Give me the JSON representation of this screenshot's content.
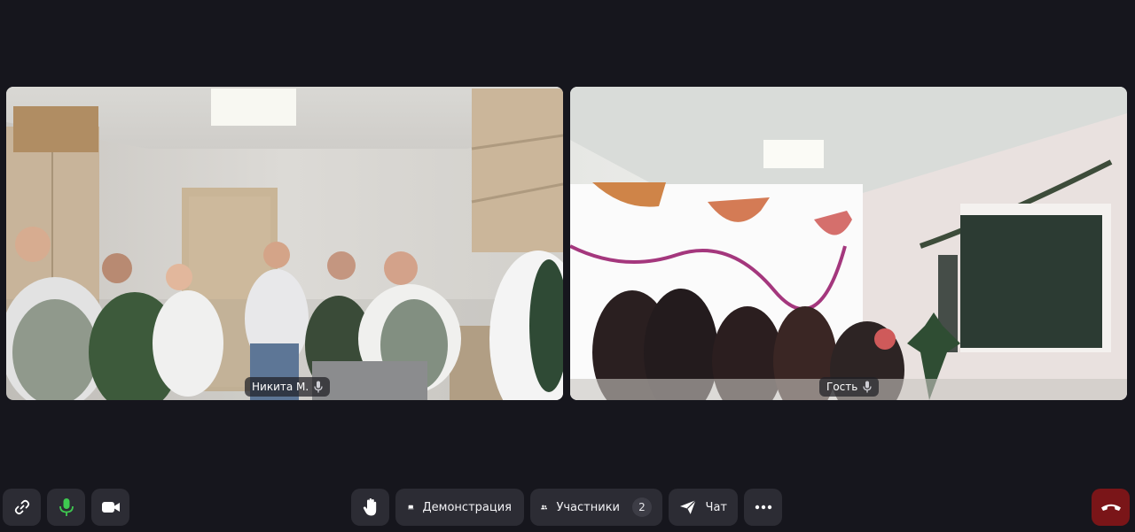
{
  "participants": [
    {
      "name": "Никита М.",
      "mic_icon": "microphone-icon"
    },
    {
      "name": "Гость",
      "mic_icon": "microphone-icon"
    }
  ],
  "toolbar": {
    "link_icon": "link-icon",
    "mic_icon": "microphone-icon",
    "mic_color": "#3ec950",
    "camera_icon": "video-camera-icon",
    "hand_icon": "raise-hand-icon",
    "demo_label": "Демонстрация",
    "demo_icon": "screen-share-icon",
    "participants_label": "Участники",
    "participants_count": "2",
    "participants_icon": "people-icon",
    "chat_label": "Чат",
    "chat_icon": "paper-plane-icon",
    "more_icon": "more-dots-icon",
    "hangup_icon": "end-call-icon",
    "hangup_color": "#7a1518"
  }
}
